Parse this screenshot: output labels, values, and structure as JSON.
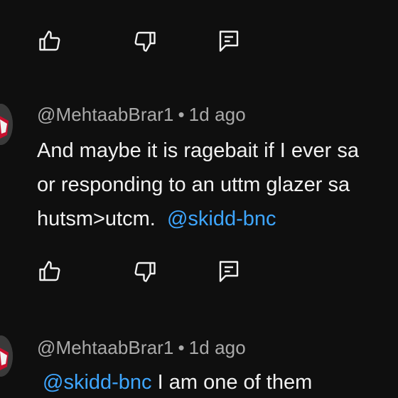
{
  "comments": [
    {
      "author": "@MehtaabBrar1",
      "separator": "•",
      "time": "1d ago",
      "lines": [
        "And maybe it is ragebait if I ever sa",
        "or responding to an uttm glazer sa",
        "hutsm>utcm."
      ],
      "trailing_mention": "@skidd-bnc"
    },
    {
      "author": "@MehtaabBrar1",
      "separator": "•",
      "time": "1d ago",
      "leading_mention": "@skidd-bnc",
      "text": " I am one of them"
    }
  ],
  "actions": {
    "like_icon": "thumbs-up-icon",
    "dislike_icon": "thumbs-down-icon",
    "reply_icon": "reply-comment-icon"
  },
  "colors": {
    "background": "#0f0f0f",
    "text": "#f1f1f1",
    "meta": "#aaaaaa",
    "mention": "#3ea6ff",
    "icon": "#f1f1f1"
  }
}
